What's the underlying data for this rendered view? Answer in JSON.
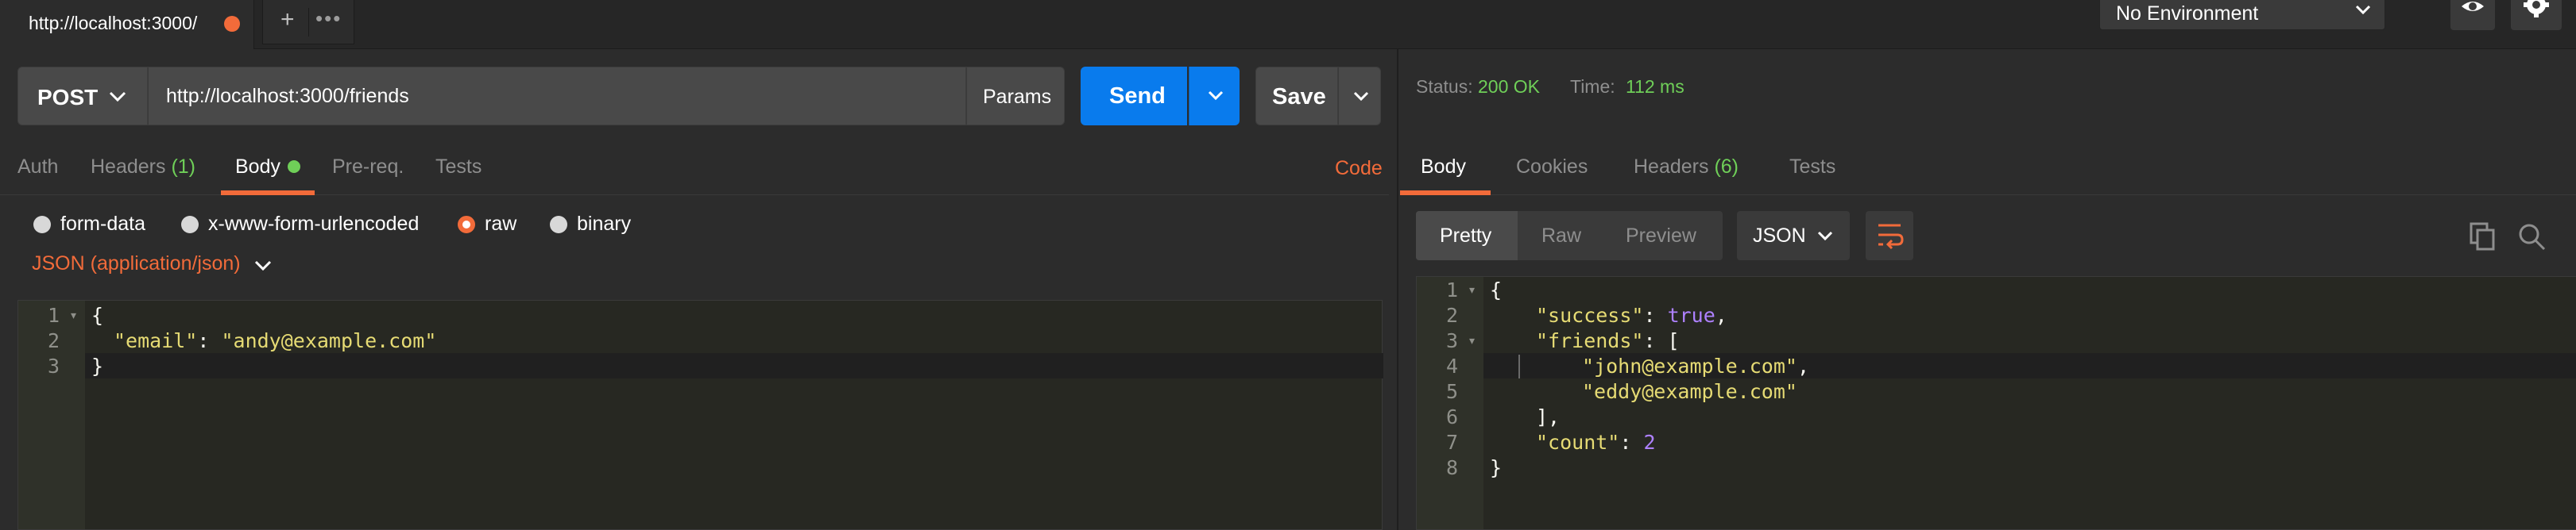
{
  "tab": {
    "url": "http://localhost:3000/"
  },
  "tab_tools": {
    "plus": "+",
    "more": "•••"
  },
  "environment": {
    "selected": "No Environment"
  },
  "request": {
    "method": "POST",
    "url": "http://localhost:3000/friends",
    "params_label": "Params",
    "send_label": "Send",
    "save_label": "Save"
  },
  "request_tabs": [
    {
      "label": "Auth",
      "count": ""
    },
    {
      "label": "Headers",
      "count": "(1)"
    },
    {
      "label": "Body",
      "count": ""
    },
    {
      "label": "Pre-req.",
      "count": ""
    },
    {
      "label": "Tests",
      "count": ""
    }
  ],
  "code_link": "Code",
  "body_types": [
    "form-data",
    "x-www-form-urlencoded",
    "raw",
    "binary"
  ],
  "body_type_selected": "raw",
  "content_type": "JSON (application/json)",
  "request_body": {
    "line_numbers": [
      "1",
      "2",
      "3"
    ],
    "open_brace": "{",
    "key": "\"email\"",
    "colon": ": ",
    "value": "\"andy@example.com\"",
    "close_brace": "}"
  },
  "response": {
    "status_label": "Status:",
    "status_value": "200 OK",
    "time_label": "Time:",
    "time_value": "112 ms",
    "tabs": [
      {
        "label": "Body",
        "count": ""
      },
      {
        "label": "Cookies",
        "count": ""
      },
      {
        "label": "Headers",
        "count": "(6)"
      },
      {
        "label": "Tests",
        "count": ""
      }
    ],
    "views": [
      "Pretty",
      "Raw",
      "Preview"
    ],
    "format": "JSON",
    "line_numbers": [
      "1",
      "2",
      "3",
      "4",
      "5",
      "6",
      "7",
      "8"
    ],
    "body": {
      "open_brace": "{",
      "success_key": "\"success\"",
      "success_value": "true",
      "friends_key": "\"friends\"",
      "open_bracket": "[",
      "friend_1": "\"john@example.com\"",
      "friend_2": "\"eddy@example.com\"",
      "close_bracket": "],",
      "count_key": "\"count\"",
      "count_value": "2",
      "close_brace": "}"
    }
  },
  "colors": {
    "accent": "#f26b3a",
    "send": "#097bed",
    "ok": "#6fcf58"
  }
}
